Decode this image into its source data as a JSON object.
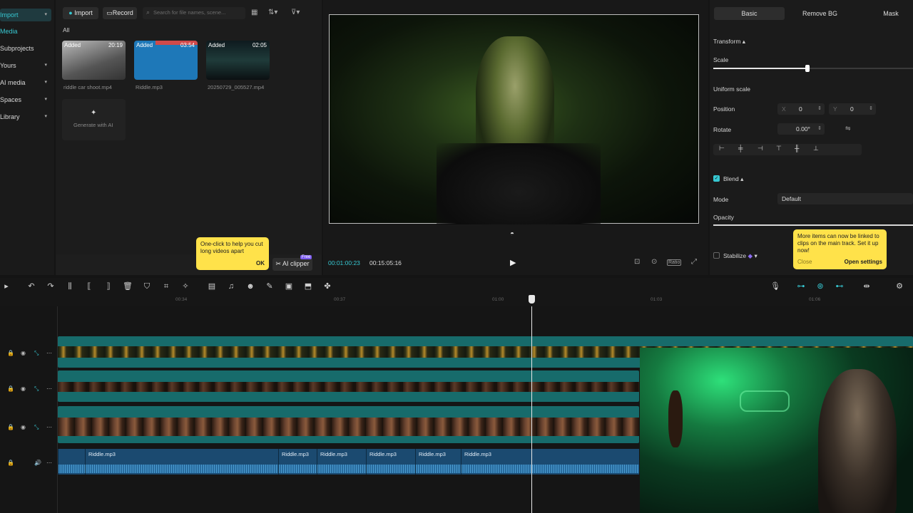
{
  "leftnav": {
    "items": [
      {
        "label": "Import",
        "active": true
      },
      {
        "label": "Media"
      },
      {
        "label": "Subprojects"
      },
      {
        "label": "Yours"
      },
      {
        "label": "AI media"
      },
      {
        "label": "Spaces"
      },
      {
        "label": "Library"
      }
    ]
  },
  "media": {
    "import_label": "Import",
    "record_label": "Record",
    "search_placeholder": "Search for file names, scene...",
    "filter_all": "All",
    "items": [
      {
        "tag": "Added",
        "duration": "20:19",
        "name": "riddle car shoot.mp4"
      },
      {
        "tag": "Added",
        "duration": "03:54",
        "name": "Riddle.mp3"
      },
      {
        "tag": "Added",
        "duration": "02:05",
        "name": "20250729_005527.mp4"
      }
    ],
    "generate_label": "Generate with AI"
  },
  "tooltip_left": {
    "text": "One-click to help you cut long videos apart",
    "ok": "OK"
  },
  "ai_clipper": {
    "label": "AI clipper",
    "badge": "Free"
  },
  "player": {
    "current_time": "00:01:00:23",
    "total_time": "00:15:05:16",
    "ratio_label": "Ratio"
  },
  "inspector": {
    "tabs": [
      "Basic",
      "Remove BG",
      "Mask"
    ],
    "transform_label": "Transform",
    "scale_label": "Scale",
    "scale_value": 0.47,
    "uniform_scale_label": "Uniform scale",
    "position_label": "Position",
    "pos_x_label": "X",
    "pos_x": "0",
    "pos_y_label": "Y",
    "pos_y": "0",
    "rotate_label": "Rotate",
    "rotate_value": "0.00°",
    "blend_label": "Blend",
    "mode_label": "Mode",
    "mode_value": "Default",
    "opacity_label": "Opacity",
    "stabilize_label": "Stabilize"
  },
  "tooltip_right": {
    "text": "More items can now be linked to clips on the main track. Set it up now!",
    "close": "Close",
    "open": "Open settings"
  },
  "ruler": {
    "labels": [
      "00:34",
      "00:37",
      "01:00",
      "01:03",
      "01:06"
    ]
  },
  "tracks": {
    "audio_clips": [
      "Riddle.mp3",
      "Riddle.mp3",
      "Riddle.mp3",
      "Riddle.mp3",
      "Riddle.mp3",
      "Riddle.mp3"
    ]
  },
  "colors": {
    "accent": "#37c8d2",
    "track_teal": "#176b6b",
    "audio_blue": "#1b4a70",
    "tooltip": "#ffe24a"
  }
}
